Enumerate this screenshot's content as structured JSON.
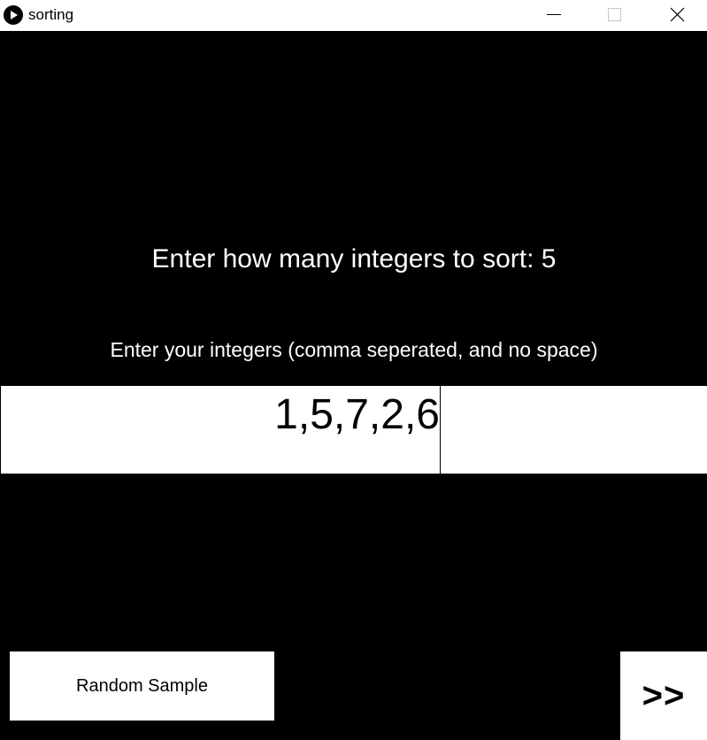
{
  "window": {
    "title": "sorting",
    "app_icon": "play-icon",
    "controls": [
      "minimize-icon",
      "maximize-icon",
      "close-icon"
    ]
  },
  "canvas": {
    "background": "#000000",
    "count_prompt": "Enter how many integers to sort: 5",
    "integers_prompt": "Enter your integers (comma seperated, and no space)",
    "input_value": "1,5,7,2,6",
    "random_button_label": "Random Sample",
    "next_button_label": ">>"
  }
}
